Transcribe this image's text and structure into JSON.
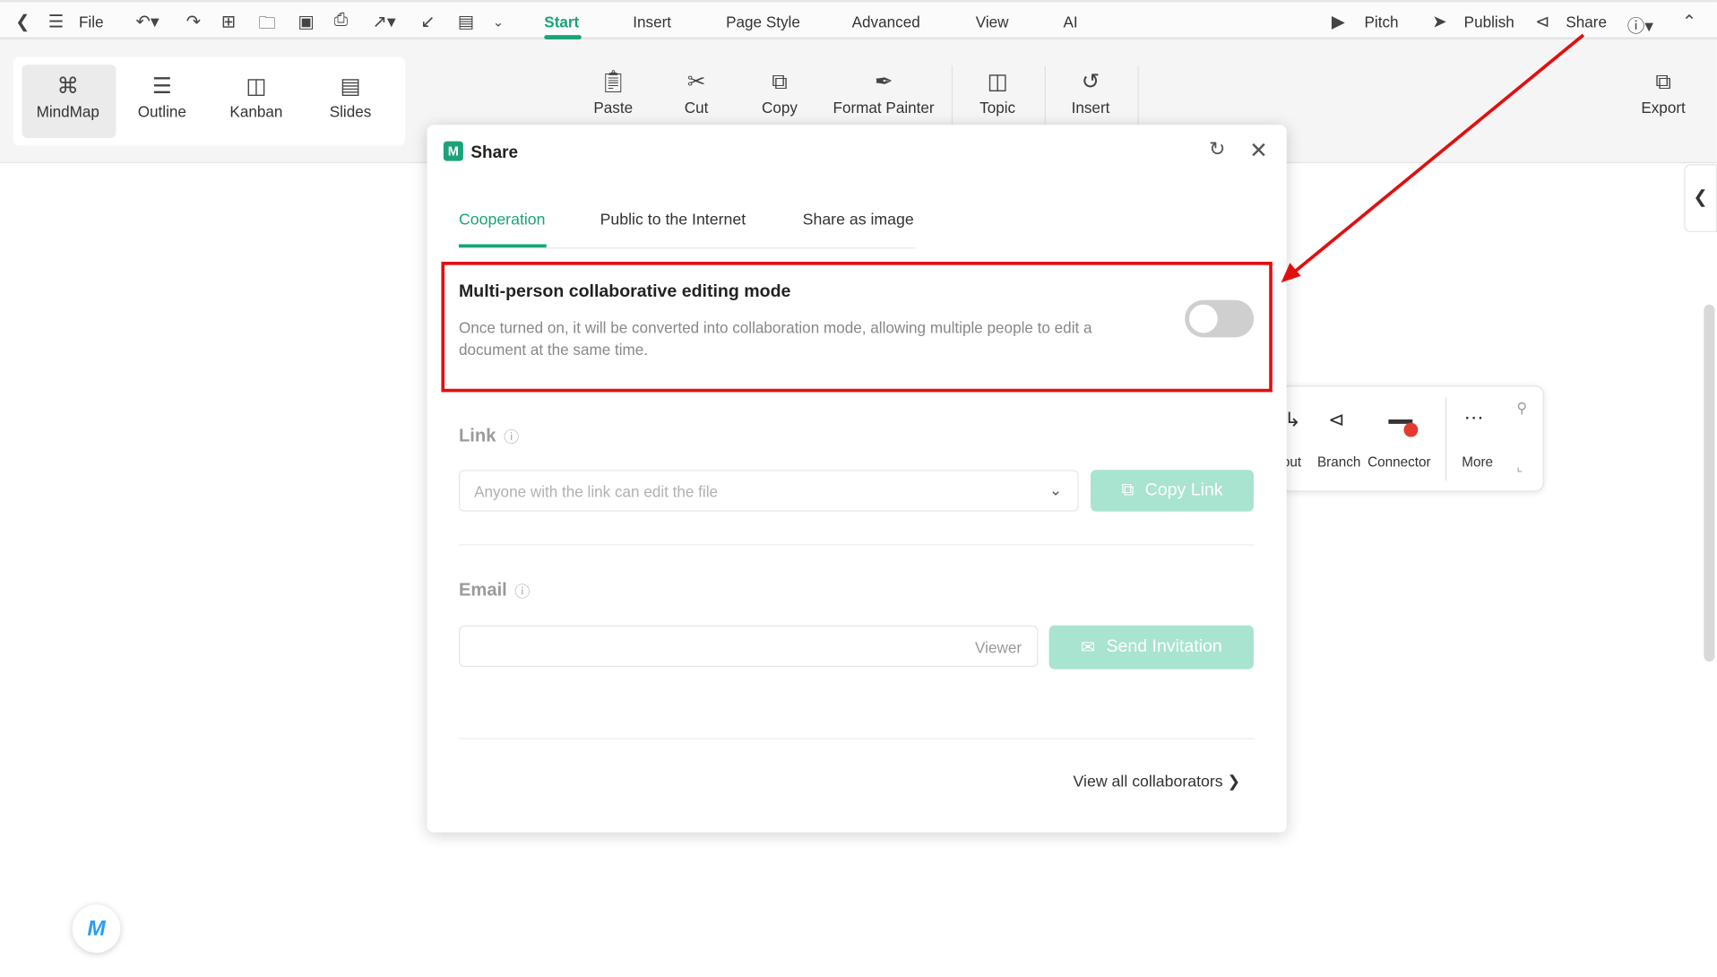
{
  "topbar": {
    "file": "File",
    "tabs": [
      "Start",
      "Insert",
      "Page Style",
      "Advanced",
      "View",
      "AI"
    ],
    "active_tab": "Start",
    "pitch": "Pitch",
    "publish": "Publish",
    "share": "Share"
  },
  "ribbon": {
    "views": [
      "MindMap",
      "Outline",
      "Kanban",
      "Slides"
    ],
    "active_view": "MindMap",
    "tools": [
      "Paste",
      "Cut",
      "Copy",
      "Format Painter",
      "Topic",
      "Insert"
    ],
    "export": "Export"
  },
  "dialog": {
    "title": "Share",
    "tabs": [
      "Cooperation",
      "Public to the Internet",
      "Share as image"
    ],
    "active_tab": "Cooperation",
    "collab": {
      "title": "Multi-person collaborative editing mode",
      "description_line1": "Once turned on, it will be converted into collaboration mode, allowing multiple people to edit a",
      "description_line2": "document at the same time.",
      "enabled": false
    },
    "link": {
      "label": "Link",
      "permission": "Anyone with the link can edit the file",
      "copy_button": "Copy Link"
    },
    "email": {
      "label": "Email",
      "value": "",
      "role": "Viewer",
      "send_button": "Send Invitation"
    },
    "view_all": "View all collaborators"
  },
  "floating_toolbar": {
    "items": [
      "out",
      "Branch",
      "Connector",
      "More"
    ]
  },
  "colors": {
    "accent": "#1aa37a",
    "button_disabled": "#a8e4cf",
    "highlight": "#e01010"
  }
}
